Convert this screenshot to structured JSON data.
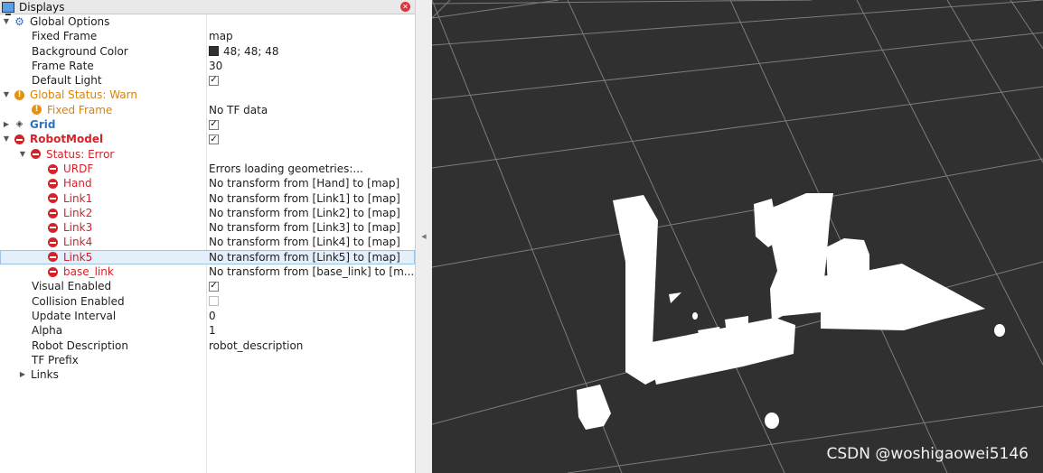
{
  "panel": {
    "title": "Displays"
  },
  "tree": {
    "global_options": {
      "label": "Global Options"
    },
    "fixed_frame": {
      "label": "Fixed Frame",
      "value": "map"
    },
    "background_color": {
      "label": "Background Color",
      "value": "48; 48; 48",
      "color": "#303030"
    },
    "frame_rate": {
      "label": "Frame Rate",
      "value": "30"
    },
    "default_light": {
      "label": "Default Light",
      "checked": true
    },
    "global_status": {
      "label": "Global Status: Warn"
    },
    "status_fixed_frame": {
      "label": "Fixed Frame",
      "value": "No TF data"
    },
    "grid": {
      "label": "Grid",
      "checked": true
    },
    "robot_model": {
      "label": "RobotModel",
      "checked": true
    },
    "status_error": {
      "label": "Status: Error"
    },
    "errors": [
      {
        "label": "URDF",
        "value": "Errors loading geometries:..."
      },
      {
        "label": "Hand",
        "value": "No transform from [Hand] to [map]"
      },
      {
        "label": "Link1",
        "value": "No transform from [Link1] to [map]"
      },
      {
        "label": "Link2",
        "value": "No transform from [Link2] to [map]"
      },
      {
        "label": "Link3",
        "value": "No transform from [Link3] to [map]"
      },
      {
        "label": "Link4",
        "value": "No transform from [Link4] to [map]"
      },
      {
        "label": "Link5",
        "value": "No transform from [Link5] to [map]"
      },
      {
        "label": "base_link",
        "value": "No transform from [base_link] to [m..."
      }
    ],
    "visual_enabled": {
      "label": "Visual Enabled",
      "checked": true
    },
    "collision_enabled": {
      "label": "Collision Enabled",
      "checked": false
    },
    "update_interval": {
      "label": "Update Interval",
      "value": "0"
    },
    "alpha": {
      "label": "Alpha",
      "value": "1"
    },
    "robot_description": {
      "label": "Robot Description",
      "value": "robot_description"
    },
    "tf_prefix": {
      "label": "TF Prefix"
    },
    "links": {
      "label": "Links"
    }
  },
  "colors": {
    "warn": "#d9820b",
    "error": "#d2232a",
    "grid_label": "#2a73c8",
    "viewport_bg": "#303030"
  },
  "viewport": {
    "watermark": "CSDN @woshigaowei5146"
  }
}
